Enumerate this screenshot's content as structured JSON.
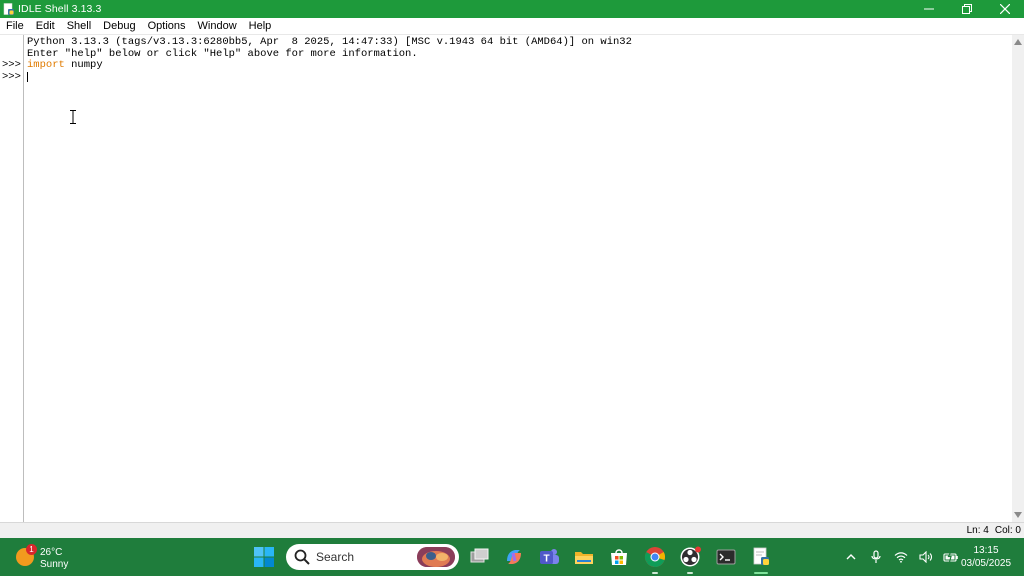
{
  "window": {
    "title": "IDLE Shell 3.13.3",
    "minimize": "—",
    "close": "✕"
  },
  "menu": [
    "File",
    "Edit",
    "Shell",
    "Debug",
    "Options",
    "Window",
    "Help"
  ],
  "shell": {
    "banner_line1": "Python 3.13.3 (tags/v3.13.3:6280bb5, Apr  8 2025, 14:47:33) [MSC v.1943 64 bit (AMD64)] on win32",
    "banner_line2": "Enter \"help\" below or click \"Help\" above for more information.",
    "prompts": [
      ">>>",
      ">>>"
    ],
    "command_keyword": "import",
    "command_rest": " numpy"
  },
  "status": {
    "line": "Ln: 4",
    "col": "Col: 0"
  },
  "taskbar": {
    "weather_badge": "1",
    "temperature": "26°C",
    "condition": "Sunny",
    "search_label": "Search",
    "time": "13:15",
    "date": "03/05/2025"
  },
  "colors": {
    "titlebar": "#1e9a3b",
    "taskbar": "#1f7d3c",
    "keyword": "#e07b00"
  },
  "icons": {
    "app": "idle-icon",
    "minimize": "minimize-icon",
    "maximize": "restore-icon",
    "close": "close-icon",
    "start": "windows-start-icon",
    "search": "search-icon",
    "task_view": "task-view-icon",
    "copilot": "copilot-icon",
    "teams": "teams-icon",
    "explorer": "file-explorer-icon",
    "store": "store-icon",
    "chrome": "chrome-icon",
    "obs": "obs-icon",
    "terminal": "terminal-icon",
    "idle_taskbar": "idle-taskbar-icon",
    "tray_up": "chevron-up-icon",
    "mic": "microphone-icon",
    "wifi": "wifi-icon",
    "volume": "volume-icon",
    "battery": "battery-icon"
  }
}
